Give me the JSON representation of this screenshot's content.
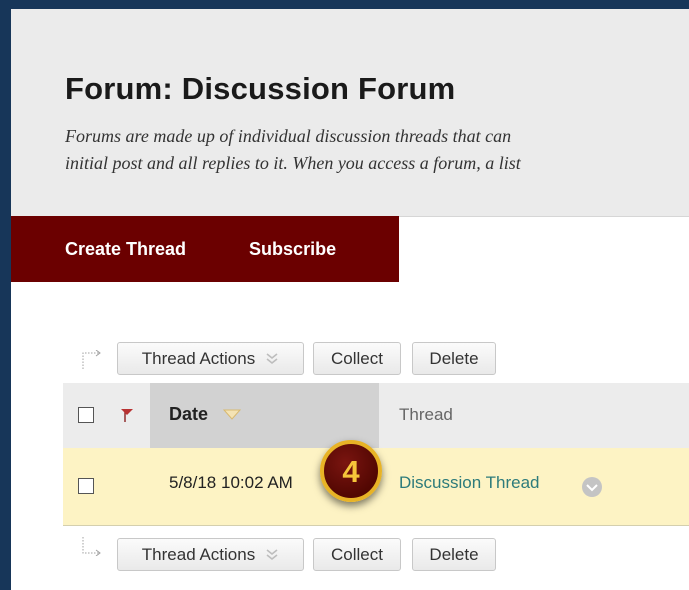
{
  "header": {
    "title": "Forum: Discussion Forum",
    "description_line1": "Forums are made up of individual discussion threads that can",
    "description_line2": "initial post and all replies to it. When you access a forum, a list"
  },
  "action_bar": {
    "create_thread": "Create Thread",
    "subscribe": "Subscribe"
  },
  "toolbar_top": {
    "thread_actions": "Thread Actions",
    "collect": "Collect",
    "delete": "Delete"
  },
  "toolbar_bottom": {
    "thread_actions": "Thread Actions",
    "collect": "Collect",
    "delete": "Delete"
  },
  "table": {
    "columns": {
      "date": "Date",
      "thread": "Thread"
    },
    "rows": [
      {
        "date": "5/8/18 10:02 AM",
        "thread": "Discussion Thread"
      }
    ]
  },
  "callout": {
    "number": "4"
  },
  "colors": {
    "background_frame": "#173659",
    "action_bar": "#6b0000",
    "selected_row": "#fdf3c4",
    "thread_link": "#2d7b7b",
    "callout_ring": "#e8b326",
    "callout_fill": "#520702"
  },
  "icons": {
    "sort": "chevron-down-icon",
    "flag": "flag-icon",
    "thread_actions_chevron": "double-chevron-down-icon",
    "row_menu": "circle-chevron-down-icon",
    "toolbar_arrow": "dotted-arrow-icon"
  }
}
